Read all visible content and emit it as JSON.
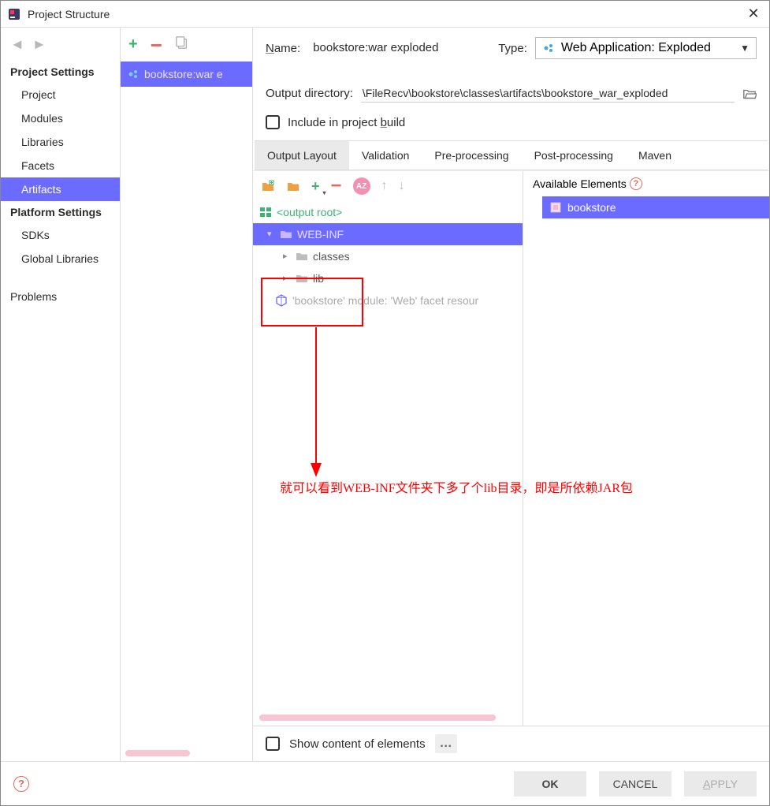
{
  "window": {
    "title": "Project Structure"
  },
  "sidebar": {
    "head1": "Project Settings",
    "items1": [
      "Project",
      "Modules",
      "Libraries",
      "Facets",
      "Artifacts"
    ],
    "head2": "Platform Settings",
    "items2": [
      "SDKs",
      "Global Libraries"
    ],
    "problems": "Problems"
  },
  "artifactList": {
    "item": "bookstore:war e"
  },
  "form": {
    "nameLabel": "Name:",
    "name": "bookstore:war exploded",
    "typeLabel": "Type:",
    "type": "Web Application: Exploded",
    "outDirLabel": "Output directory:",
    "outDir": "\\FileRecv\\bookstore\\classes\\artifacts\\bookstore_war_exploded",
    "includeBuild": "Include in project build"
  },
  "tabs": [
    "Output Layout",
    "Validation",
    "Pre-processing",
    "Post-processing",
    "Maven"
  ],
  "tree": {
    "root": "<output root>",
    "webinf": "WEB-INF",
    "classes": "classes",
    "lib": "lib",
    "module": "'bookstore' module: 'Web' facet resour"
  },
  "available": {
    "title": "Available Elements",
    "item": "bookstore"
  },
  "bottom": {
    "showContent": "Show content of elements"
  },
  "buttons": {
    "ok": "OK",
    "cancel": "CANCEL",
    "apply_pre": "A",
    "apply_rest": "PPLY"
  },
  "annotation": {
    "text": "就可以看到WEB-INF文件夹下多了个lib目录，即是所依赖JAR包"
  },
  "toolbar_az": "AZ"
}
